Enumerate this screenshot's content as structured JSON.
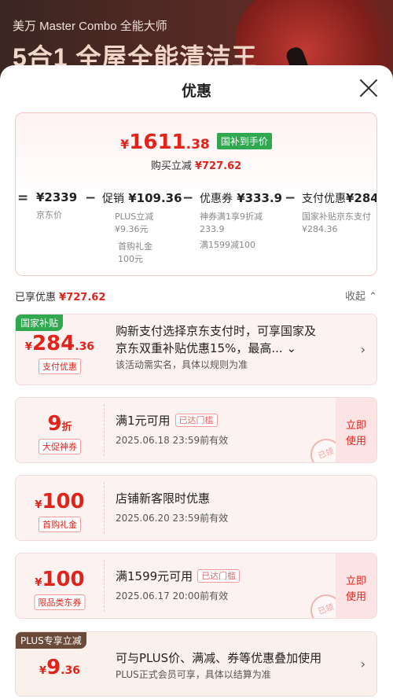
{
  "banner": {
    "brand_line": "美万 Master Combo 全能大师",
    "headline": "5合1 全屋全能清洁王"
  },
  "sheet": {
    "title": "优惠",
    "close_icon": "close-icon"
  },
  "summary": {
    "currency": "¥",
    "price_int": "1611",
    "price_dec": ".38",
    "badge": "国补到手价",
    "reduce_label": "购买立减",
    "reduce_amount": "¥727.62",
    "formula": [
      {
        "op": "=",
        "value": "¥2339",
        "label": "",
        "subs": [
          "京东价"
        ]
      },
      {
        "op": "−",
        "value": "¥109.36",
        "label": "促销",
        "subs": [
          "PLUS立减",
          "¥9.36元",
          "首购礼金",
          "100元"
        ]
      },
      {
        "op": "−",
        "value": "¥333.9",
        "label": "优惠券",
        "subs": [
          "神券满1享9折减",
          "233.9",
          "满1599减100"
        ]
      },
      {
        "op": "−",
        "value": "¥284",
        "label": "支付优惠",
        "subs": [
          "国家补贴京东支付",
          "¥284.36"
        ]
      }
    ]
  },
  "enjoyed": {
    "label": "已享优惠",
    "amount": "¥727.62",
    "collapse_label": "收起"
  },
  "cards": {
    "subsidy": {
      "tag": "国家补贴",
      "currency": "¥",
      "amount_int": "284",
      "amount_dec": ".36",
      "chip": "支付优惠",
      "title_line1": "购新支付选择京东支付时，可享国家及",
      "title_line2": "京东双重补贴优惠15%，最高...",
      "note": "该活动需实名，具体以规则为准"
    },
    "discount": {
      "amount_int": "9",
      "unit": "折",
      "chip": "大促神券",
      "title": "满1元可用",
      "reached": "已达门槛",
      "valid": "2025.06.18 23:59前有效",
      "use_line1": "立即",
      "use_line2": "使用",
      "stamp": "已领"
    },
    "gift": {
      "currency": "¥",
      "amount_int": "100",
      "chip": "首购礼金",
      "title": "店铺新客限时优惠",
      "valid": "2025.06.20 23:59前有效"
    },
    "category": {
      "currency": "¥",
      "amount_int": "100",
      "chip": "限品类东券",
      "title": "满1599元可用",
      "reached": "已达门槛",
      "valid": "2025.06.17 20:00前有效",
      "use_line1": "立即",
      "use_line2": "使用",
      "stamp": "已领"
    },
    "plus": {
      "tag": "PLUS专享立减",
      "currency": "¥",
      "amount_int": "9",
      "amount_dec": ".36",
      "title": "可与PLUS价、满减、券等优惠叠加使用",
      "note": "PLUS正式会员可享，具体以结算为准"
    }
  },
  "colors": {
    "accent_red": "#e2231a",
    "badge_green": "#2fa84f",
    "subsidy_tag_green": "#2fa84f",
    "plus_tag_brown": "#6b4a3a"
  }
}
